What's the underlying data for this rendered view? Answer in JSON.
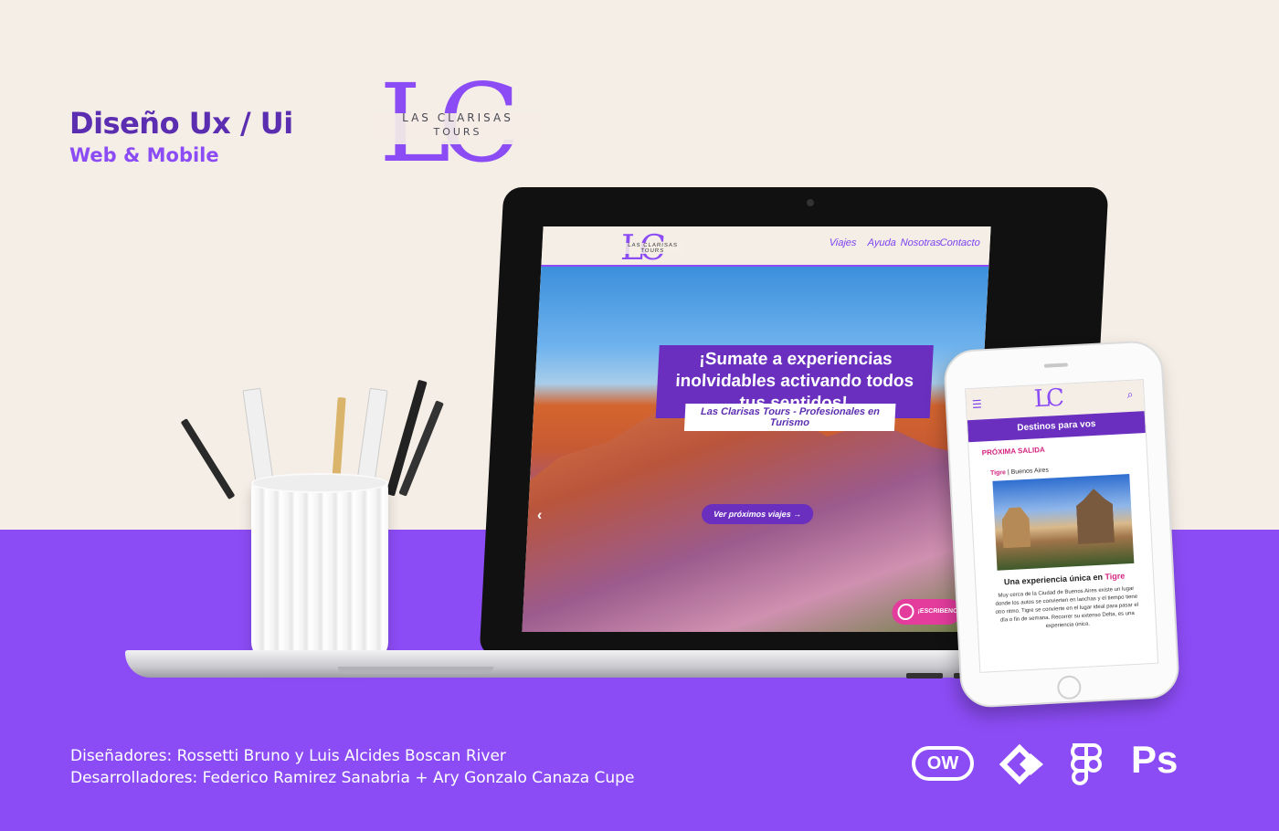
{
  "headline": {
    "title": "Diseño Ux / Ui",
    "subtitle": "Web & Mobile"
  },
  "brand": {
    "monogram": "LC",
    "line1": "LAS CLARISAS",
    "line2": "TOURS",
    "color": "#8c4cf5"
  },
  "website": {
    "nav": [
      "Viajes",
      "Ayuda",
      "Nosotras",
      "Contacto"
    ],
    "logo_monogram": "LC",
    "logo_text": "LAS CLARISAS TOURS",
    "hero_title": "¡Sumate a experiencias inolvidables activando todos tus sentidos!",
    "hero_subtitle": "Las Clarisas Tours - Profesionales en Turismo",
    "cta_label": "Ver próximos viajes →",
    "carousel_prev": "‹",
    "whatsapp_label": "¡ESCRIBENOS!"
  },
  "mobile": {
    "menu_icon": "☰",
    "search_icon": "⌕",
    "logo_monogram": "LC",
    "section_title": "Destinos para vos",
    "next_departure": "PRÓXIMA SALIDA",
    "location_city": "Tigre",
    "location_region": "| Buenos Aires",
    "experience_prefix": "Una experiencia única en",
    "experience_city": "Tigre",
    "body": "Muy cerca de la Ciudad de Buenos Aires existe un lugar donde los autos se convierten en lanchas y el tiempo tiene otro ritmo. Tigre se convierte en el lugar ideal para pasar el día o fin de semana. Recorrer su extenso Delta, es una experiencia única."
  },
  "credits": {
    "designers": "Diseñadores: Rossetti Bruno y Luis Alcides Boscan River",
    "developers": "Desarrolladores: Federico Ramirez Sanabria + Ary Gonzalo Canaza Cupe"
  },
  "tools": {
    "ow_label": "OW",
    "ps_label": "Ps",
    "icons": [
      "ow-icon",
      "zeplin-icon",
      "figma-icon",
      "photoshop-icon"
    ]
  },
  "colors": {
    "purple": "#8c4cf5",
    "dark_purple": "#5b2db0",
    "pink": "#d4247f",
    "cream": "#f5eee6"
  }
}
